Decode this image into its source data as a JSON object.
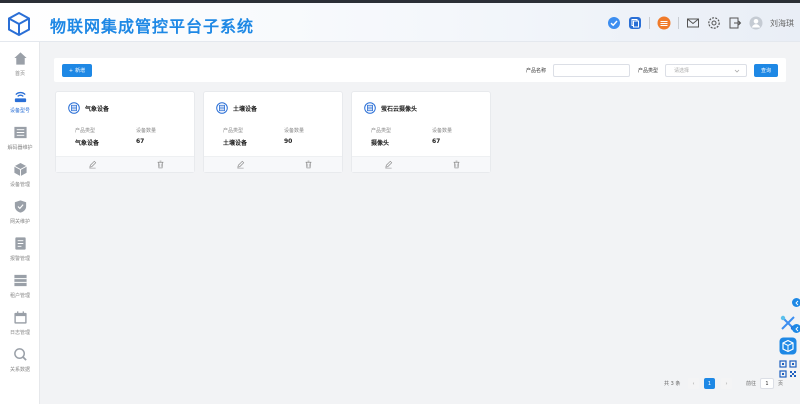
{
  "app": {
    "title": "物联网集成管控平台子系统",
    "accent": "#1e88e5"
  },
  "header": {
    "username": "刘海琪"
  },
  "sidebar": {
    "items": [
      {
        "label": "首页",
        "icon": "home-icon"
      },
      {
        "label": "设备型号",
        "icon": "router-icon",
        "active": true
      },
      {
        "label": "解码器维护",
        "icon": "decoder-icon"
      },
      {
        "label": "设备管理",
        "icon": "cube-icon"
      },
      {
        "label": "网关维护",
        "icon": "shield-icon"
      },
      {
        "label": "报警管理",
        "icon": "alarm-doc-icon"
      },
      {
        "label": "租户管理",
        "icon": "tenant-list-icon"
      },
      {
        "label": "日志管理",
        "icon": "calendar-icon"
      },
      {
        "label": "关系数据",
        "icon": "relation-icon"
      }
    ]
  },
  "toolbar": {
    "add_label": "新增",
    "product_name_label": "产品名称",
    "product_name_value": "",
    "product_type_label": "产品类型",
    "product_type_placeholder": "请选择",
    "query_label": "查询"
  },
  "cards": [
    {
      "name": "气象设备",
      "type_label": "产品类型",
      "count_label": "设备数量",
      "type_value": "气象设备",
      "count_value": "67"
    },
    {
      "name": "土壤设备",
      "type_label": "产品类型",
      "count_label": "设备数量",
      "type_value": "土壤设备",
      "count_value": "90"
    },
    {
      "name": "萤石云摄像头",
      "type_label": "产品类型",
      "count_label": "设备数量",
      "type_value": "摄像头",
      "count_value": "67"
    }
  ],
  "pagination": {
    "total_text": "共 3 条",
    "current_page": "1",
    "prev": "‹",
    "next": "›",
    "goto_label": "前往",
    "goto_value": "1",
    "page_suffix": "页"
  }
}
